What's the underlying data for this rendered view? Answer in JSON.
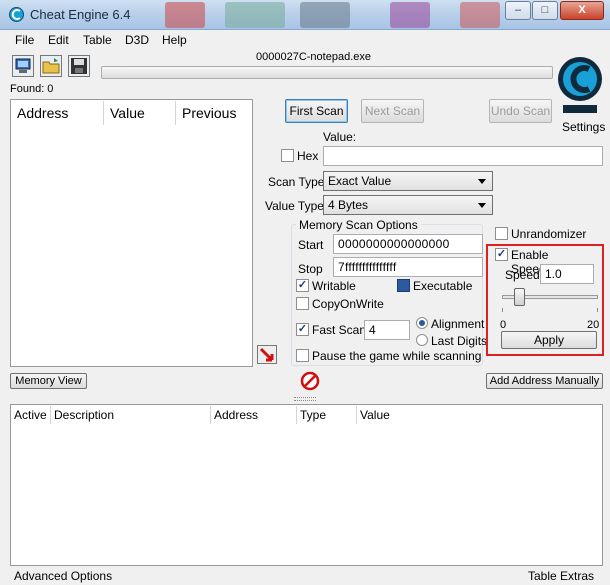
{
  "window": {
    "title": "Cheat Engine 6.4",
    "controls": {
      "minimize": "–",
      "maximize": "□",
      "close": "X"
    }
  },
  "menu": [
    "File",
    "Edit",
    "Table",
    "D3D",
    "Help"
  ],
  "process": {
    "name": "0000027C-notepad.exe",
    "progress": 0
  },
  "found_label": "Found: 0",
  "settings_label": "Settings",
  "results": {
    "columns": [
      "Address",
      "Value",
      "Previous"
    ]
  },
  "scan": {
    "first_scan": "First Scan",
    "next_scan": "Next Scan",
    "undo_scan": "Undo Scan",
    "value_label": "Value:",
    "value": "",
    "hex_label": "Hex",
    "scan_type_label": "Scan Type",
    "scan_type": "Exact Value",
    "value_type_label": "Value Type",
    "value_type": "4 Bytes"
  },
  "memory_options": {
    "title": "Memory Scan Options",
    "start_label": "Start",
    "start": "0000000000000000",
    "stop_label": "Stop",
    "stop": "7fffffffffffffff",
    "writable": "Writable",
    "executable": "Executable",
    "copy_on_write": "CopyOnWrite",
    "fast_scan": "Fast Scan",
    "fast_scan_value": "4",
    "alignment": "Alignment",
    "last_digits": "Last Digits",
    "pause": "Pause the game while scanning"
  },
  "unrandomizer": "Unrandomizer",
  "speedhack": {
    "enable_label": "Enable Speedhack",
    "speed_label": "Speed",
    "speed": "1.0",
    "slider_min": "0",
    "slider_max": "20",
    "slider_value": 1,
    "apply": "Apply"
  },
  "buttons": {
    "memory_view": "Memory View",
    "add_address": "Add Address Manually"
  },
  "address_table": {
    "columns": [
      "Active",
      "Description",
      "Address",
      "Type",
      "Value"
    ]
  },
  "footer": {
    "left": "Advanced Options",
    "right": "Table Extras"
  },
  "colors": {
    "highlight_box": "#e02020",
    "title_bar": "#b7cfe9",
    "logo": "#1aa0d8"
  },
  "icons": {
    "app": "cheat-engine-icon",
    "open_process": "computer-icon",
    "open_file": "folder-icon",
    "save": "floppy-icon",
    "arrow": "red-arrow-icon",
    "stop": "stop-icon",
    "logo": "cheat-engine-logo"
  }
}
